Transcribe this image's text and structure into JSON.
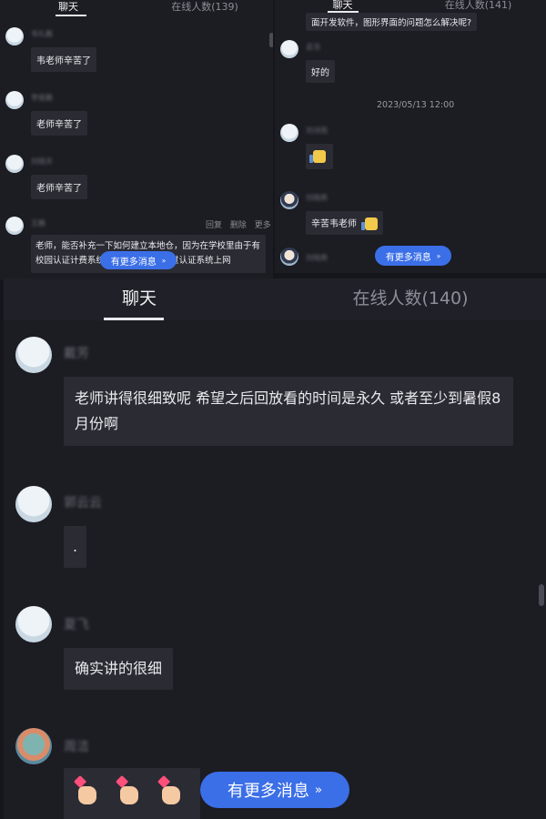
{
  "panel_a": {
    "tabs": [
      "聊天",
      "在线人数(139)"
    ],
    "messages": [
      {
        "name": "韦礼鹏",
        "text": "韦老师辛苦了"
      },
      {
        "name": "李俊鹏",
        "text": "老师辛苦了"
      },
      {
        "name": "刘晓天",
        "text": "老师辛苦了"
      },
      {
        "name": "王鹏",
        "text": "老师，能否补充一下如何建立本地仓，因为在学校里由于有校园认证计费系统……x不能直接绕过认证系统上网"
      }
    ],
    "actions": [
      "回复",
      "删除",
      "更多"
    ],
    "more_button": "有更多消息"
  },
  "panel_b": {
    "tabs": [
      "聊天",
      "在线人数(141)"
    ],
    "top_text": "面开发软件，图形界面的问题怎么解决呢?",
    "messages": [
      {
        "name": "孟浩",
        "text": "好的"
      },
      {
        "name": "刘诗雨",
        "text": ""
      },
      {
        "name": "刘晓燕",
        "text": "辛苦韦老师"
      },
      {
        "name": "刘晓燕",
        "text": ""
      }
    ],
    "timestamp": "2023/05/13 12:00",
    "more_button": "有更多消息"
  },
  "panel_c": {
    "tabs": [
      "聊天",
      "在线人数(140)"
    ],
    "messages": [
      {
        "name": "戴芳",
        "text": "老师讲得很细致呢 希望之后回放看的时间是永久  或者至少到暑假8月份啊"
      },
      {
        "name": "郭云云",
        "text": "."
      },
      {
        "name": "夏飞",
        "text": "确实讲的很细"
      },
      {
        "name": "周洁",
        "text": ""
      }
    ],
    "more_button": "有更多消息"
  },
  "colors": {
    "background": "#1c1c23",
    "bubble": "#2b2b33",
    "accent": "#3b6fe8"
  },
  "icons": {
    "thumbs_up": "thumbs-up-emoji",
    "finger_heart": "finger-heart-emoji",
    "chevron": "double-chevron-down"
  }
}
